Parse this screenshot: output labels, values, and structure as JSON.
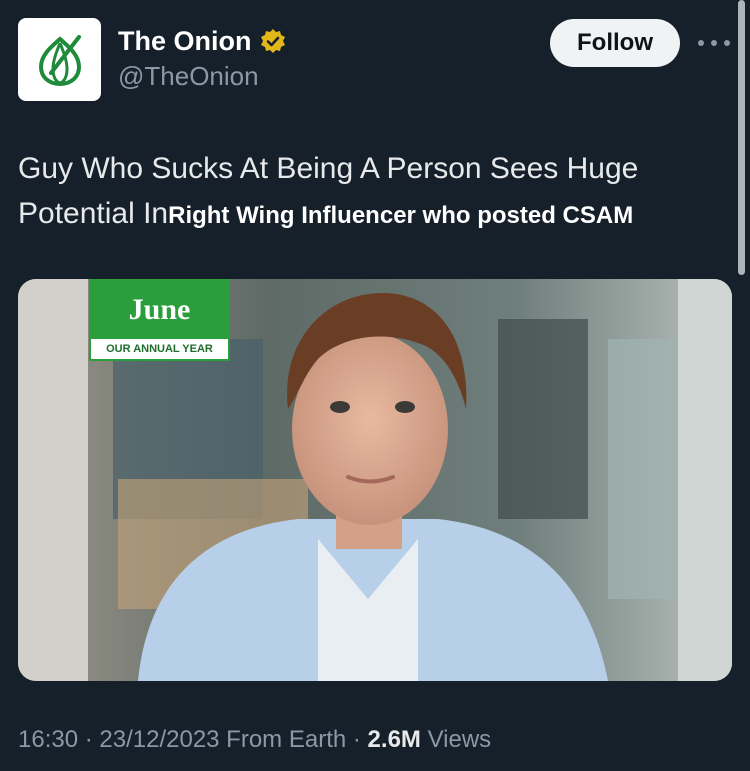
{
  "account": {
    "display_name": "The Onion",
    "handle": "@TheOnion",
    "verified_badge_icon": "verified-gold-badge-icon",
    "avatar_icon": "onion-logo-icon"
  },
  "header": {
    "follow_label": "Follow",
    "more_icon": "more-horizontal-icon"
  },
  "tweet": {
    "text_part1": "Guy Who Sucks At Being A Person Sees Huge Potential In",
    "text_overlay": "Right Wing Influencer who posted CSAM"
  },
  "media": {
    "badge_title": "June",
    "badge_subtitle": "OUR ANNUAL YEAR"
  },
  "meta": {
    "time": "16:30",
    "sep1": " · ",
    "date": "23/12/2023",
    "location": " From Earth",
    "sep2": " · ",
    "views_count": "2.6M",
    "views_label": " Views"
  },
  "colors": {
    "background": "#15202b",
    "secondary_text": "#8b98a5",
    "verified_gold": "#e2b719",
    "onion_green": "#2a9e3a"
  }
}
